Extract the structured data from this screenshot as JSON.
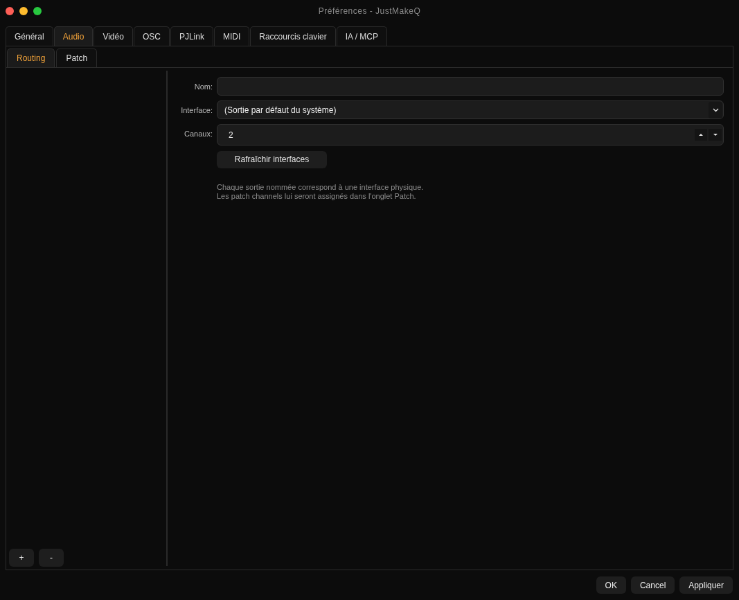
{
  "window": {
    "title": "Préférences - JustMakeQ"
  },
  "tabs": [
    {
      "label": "Général",
      "selected": false
    },
    {
      "label": "Audio",
      "selected": true
    },
    {
      "label": "Vidéo",
      "selected": false
    },
    {
      "label": "OSC",
      "selected": false
    },
    {
      "label": "PJLink",
      "selected": false
    },
    {
      "label": "MIDI",
      "selected": false
    },
    {
      "label": "Raccourcis clavier",
      "selected": false
    },
    {
      "label": "IA / MCP",
      "selected": false
    }
  ],
  "subtabs": [
    {
      "label": "Routing",
      "selected": true
    },
    {
      "label": "Patch",
      "selected": false
    }
  ],
  "outputs_list": {
    "buttons": [
      "+",
      "-"
    ]
  },
  "form": {
    "fields": [
      {
        "kind": "text",
        "label": "Nom:"
      },
      {
        "kind": "select",
        "label": "Interface:",
        "value": "(Sortie par défaut du système)"
      },
      {
        "kind": "spin",
        "label": "Canaux:",
        "value": "2"
      }
    ],
    "refresh_button": "Rafraîchir interfaces",
    "help_text": [
      "Chaque sortie nommée correspond à une interface physique.",
      "Les patch channels lui seront assignés dans l'onglet Patch."
    ]
  },
  "buttons": [
    "OK",
    "Cancel",
    "Appliquer"
  ]
}
